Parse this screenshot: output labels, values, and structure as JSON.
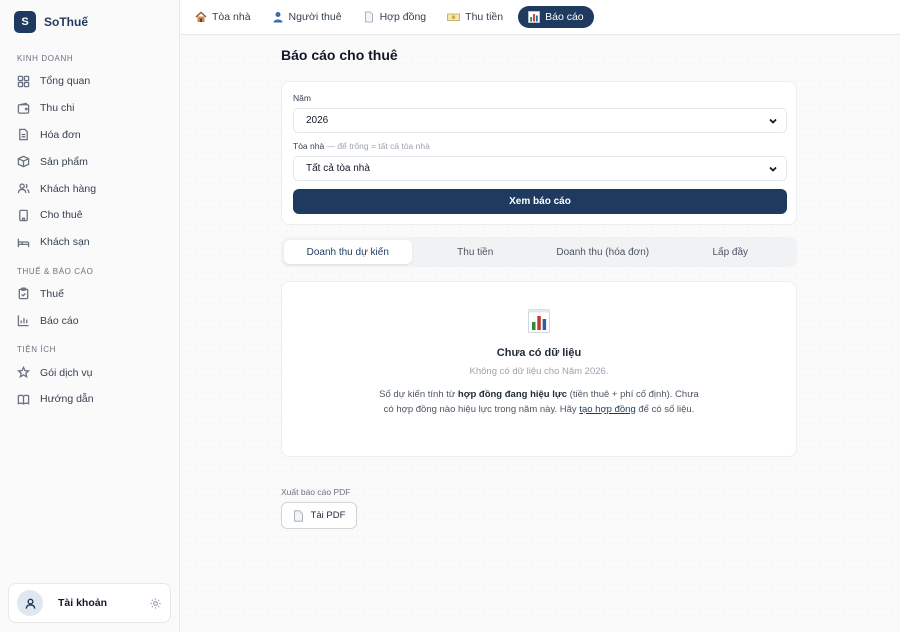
{
  "brand": {
    "logo_letter": "S",
    "name": "SoThuế"
  },
  "sidebar": {
    "sections": [
      {
        "title": "KINH DOANH",
        "items": [
          {
            "label": "Tổng quan",
            "icon": "grid-icon"
          },
          {
            "label": "Thu chi",
            "icon": "wallet-icon"
          },
          {
            "label": "Hóa đơn",
            "icon": "invoice-icon"
          },
          {
            "label": "Sản phẩm",
            "icon": "box-icon"
          },
          {
            "label": "Khách hàng",
            "icon": "users-icon"
          },
          {
            "label": "Cho thuê",
            "icon": "building-icon"
          },
          {
            "label": "Khách sạn",
            "icon": "bed-icon"
          }
        ]
      },
      {
        "title": "THUẾ & BÁO CÁO",
        "items": [
          {
            "label": "Thuế",
            "icon": "clipboard-icon"
          },
          {
            "label": "Báo cáo",
            "icon": "bar-chart-icon"
          }
        ]
      },
      {
        "title": "TIỆN ÍCH",
        "items": [
          {
            "label": "Gói dịch vụ",
            "icon": "star-icon"
          },
          {
            "label": "Hướng dẫn",
            "icon": "book-icon"
          }
        ]
      }
    ],
    "account": {
      "label": "Tài khoản"
    }
  },
  "top_tabs": [
    {
      "label": "Tòa nhà",
      "icon": "house-emoji",
      "active": false
    },
    {
      "label": "Người thuê",
      "icon": "person-emoji",
      "active": false
    },
    {
      "label": "Hợp đồng",
      "icon": "document-emoji",
      "active": false
    },
    {
      "label": "Thu tiền",
      "icon": "money-emoji",
      "active": false
    },
    {
      "label": "Báo cáo",
      "icon": "chart-emoji",
      "active": true
    }
  ],
  "page": {
    "title": "Báo cáo cho thuê",
    "form": {
      "year_label": "Năm",
      "year_value": "2026",
      "building_label": "Tòa nhà",
      "building_hint": " — để trống = tất cả tòa nhà",
      "building_value": "Tất cả tòa nhà",
      "submit_label": "Xem báo cáo"
    },
    "report_tabs": [
      {
        "label": "Doanh thu dự kiến",
        "active": true
      },
      {
        "label": "Thu tiền",
        "active": false
      },
      {
        "label": "Doanh thu (hóa đơn)",
        "active": false
      },
      {
        "label": "Lấp đầy",
        "active": false
      }
    ],
    "empty": {
      "title": "Chưa có dữ liệu",
      "subtitle": "Không có dữ liệu cho Năm 2026.",
      "desc_before": "Số dự kiến tính từ ",
      "desc_bold": "hợp đồng đang hiệu lực",
      "desc_middle": " (tiền thuê + phí cố định). Chưa có hợp đồng nào hiệu lực trong năm này. Hãy ",
      "desc_link": "tạo hợp đồng",
      "desc_after": " để có số liệu."
    },
    "export": {
      "label": "Xuất báo cáo PDF",
      "button_label": "Tải PDF"
    }
  },
  "colors": {
    "primary": "#1e3a5f",
    "background": "#fafafa"
  }
}
